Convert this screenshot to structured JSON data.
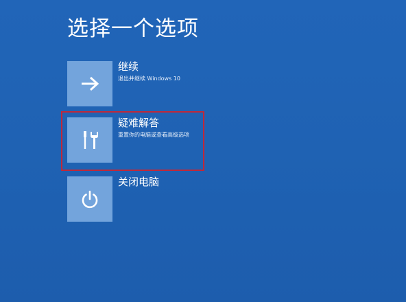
{
  "screen": {
    "title": "选择一个选项"
  },
  "options": [
    {
      "label": "继续",
      "description": "退出并继续 Windows 10",
      "icon": "arrow-right-icon"
    },
    {
      "label": "疑难解答",
      "description": "重置你的电脑或查看高级选项",
      "icon": "tools-icon"
    },
    {
      "label": "关闭电脑",
      "description": "",
      "icon": "power-icon"
    }
  ],
  "colors": {
    "background": "#1f62b4",
    "tile": "#73a4dc",
    "highlight": "#c0283a"
  }
}
